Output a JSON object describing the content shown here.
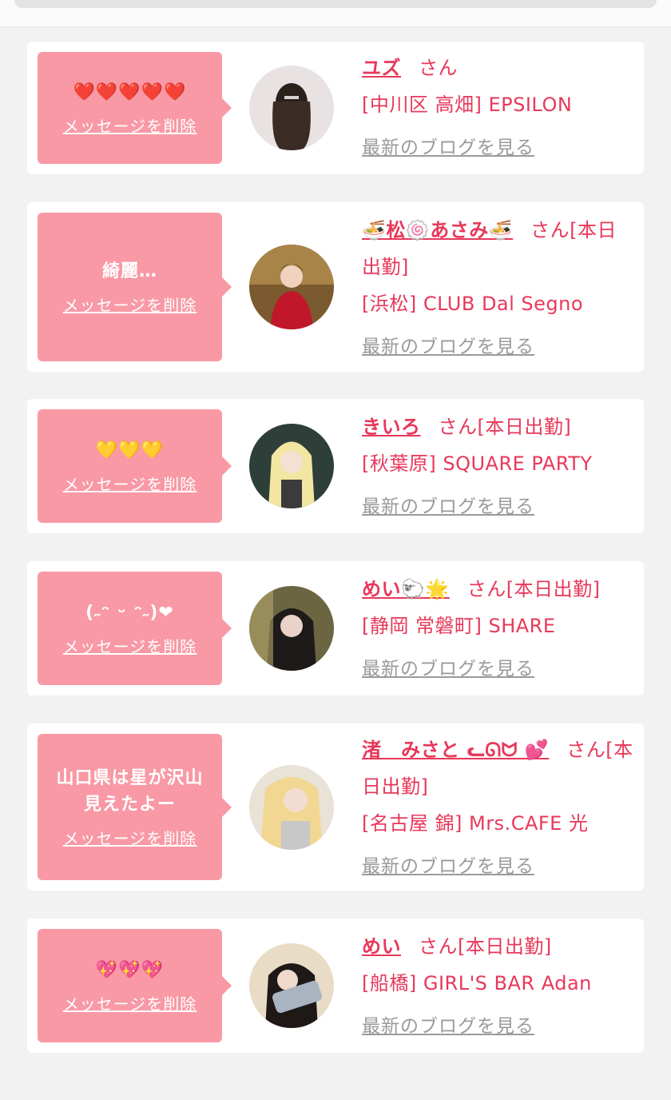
{
  "delete_label": "メッセージを削除",
  "blog_label": "最新のブログを見る",
  "san_label": "さん",
  "cards": [
    {
      "message": "❤️❤️❤️❤️❤️",
      "name": "ユズ",
      "status": "",
      "shop": "[中川区 高畑] EPSILON"
    },
    {
      "message": "綺麗…",
      "name": "🍜松🍥あさみ🍜",
      "status": "[本日出勤]",
      "shop": "[浜松] CLUB Dal Segno"
    },
    {
      "message": "💛💛💛",
      "name": "きいろ",
      "status": "[本日出勤]",
      "shop": "[秋葉原] SQUARE PARTY"
    },
    {
      "message": "(˶ᵔ ᵕ ᵔ˶)❤︎",
      "name": "めい🐑🌟",
      "status": "[本日出勤]",
      "shop": "[静岡 常磐町] SHARE"
    },
    {
      "message": "山口県は星が沢山見えたよー",
      "name": "渚　みさと ᓚᘏᗢ 💕",
      "status": "[本日出勤]",
      "shop": "[名古屋 錦] Mrs.CAFE 光"
    },
    {
      "message": "💖💖💖",
      "name": "めい",
      "status": "[本日出勤]",
      "shop": "[船橋] GIRL'S BAR Adan"
    }
  ],
  "colors": {
    "accent": "#e8385a",
    "bubble": "#f899a5",
    "link_gray": "#9a9a9a"
  }
}
